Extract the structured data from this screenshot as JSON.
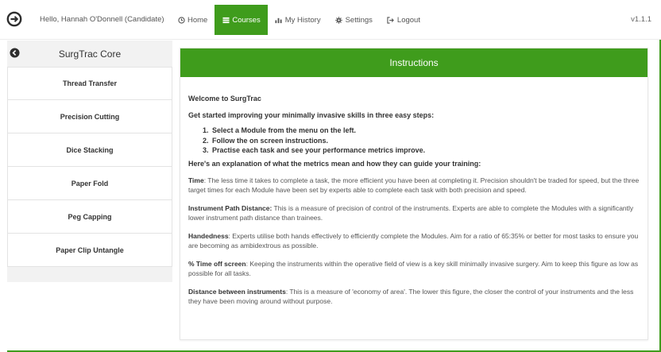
{
  "app": {
    "greeting": "Hello, Hannah O'Donnell (Candidate)",
    "version": "v1.1.1",
    "accent_color": "#3f9c1c"
  },
  "nav": {
    "items": [
      {
        "label": "Home",
        "icon": "clock-icon",
        "active": false
      },
      {
        "label": "Courses",
        "icon": "list-icon",
        "active": true
      },
      {
        "label": "My History",
        "icon": "bar-chart-icon",
        "active": false
      },
      {
        "label": "Settings",
        "icon": "gear-icon",
        "active": false
      },
      {
        "label": "Logout",
        "icon": "logout-icon",
        "active": false
      }
    ]
  },
  "sidebar": {
    "title": "SurgTrac Core",
    "items": [
      {
        "label": "Thread Transfer"
      },
      {
        "label": "Precision Cutting"
      },
      {
        "label": "Dice Stacking"
      },
      {
        "label": "Paper Fold"
      },
      {
        "label": "Peg Capping"
      },
      {
        "label": "Paper Clip Untangle"
      }
    ]
  },
  "instructions": {
    "title": "Instructions",
    "welcome": "Welcome to SurgTrac",
    "intro": "Get started improving your minimally invasive skills in three easy steps:",
    "steps": [
      "Select a Module from the menu on the left.",
      "Follow the on screen instructions.",
      "Practise each task and see your performance metrics improve."
    ],
    "explain": "Here's an explanation of what the metrics mean and how they can guide your training:",
    "metrics": [
      {
        "term": "Time",
        "sep": ": ",
        "text": "The less time it takes to complete a task, the more efficient you have been at completing it. Precision shouldn't be traded for speed, but the three target times for each Module have been set by experts able to complete each task with both precision and speed."
      },
      {
        "term": "Instrument Path Distance:",
        "sep": " ",
        "text": "This is a measure of precision of control of the instruments. Experts are able to complete the Modules with a significantly lower instrument path distance than trainees."
      },
      {
        "term": "Handedness",
        "sep": ": ",
        "text": "Experts utilise both hands effectively to efficiently complete the Modules. Aim for a ratio of 65:35% or better for most tasks to ensure you are becoming as ambidextrous as possible."
      },
      {
        "term": "% Time off screen",
        "sep": ": ",
        "text": "Keeping the instruments within the operative field of view is a key skill minimally invasive surgery. Aim to keep this figure as low as possible for all tasks."
      },
      {
        "term": "Distance between instruments",
        "sep": ": ",
        "text": "This is a measure of 'economy of area'. The lower this figure, the closer the control of your instruments and the less they have been moving around without purpose."
      }
    ]
  }
}
